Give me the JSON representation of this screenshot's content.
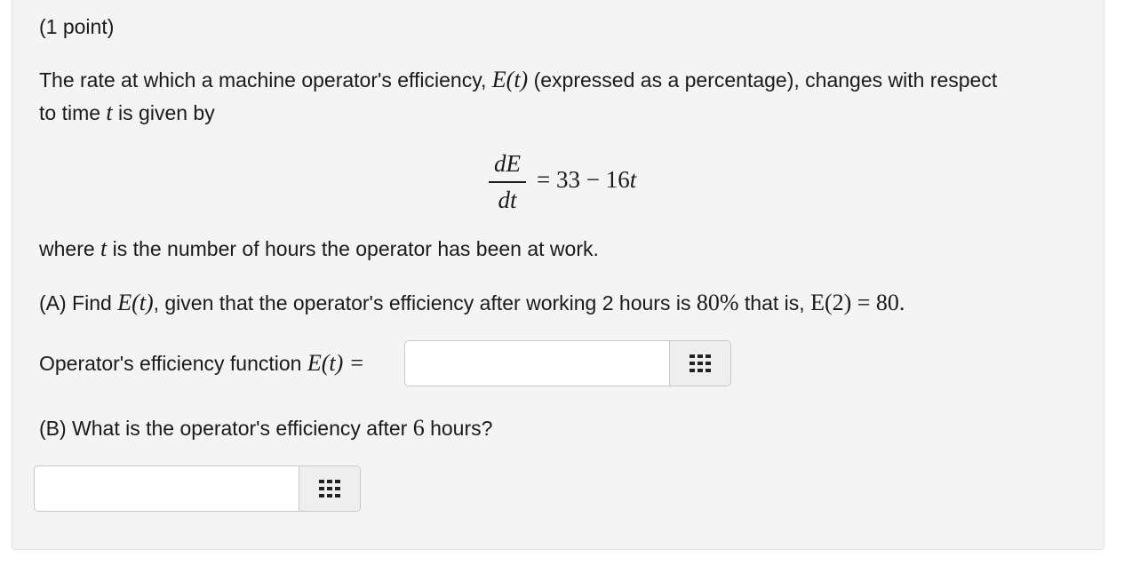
{
  "problem": {
    "points": "(1 point)",
    "intro": {
      "pre": "The rate at which a machine operator's efficiency, ",
      "func": "E(t)",
      "post": " (expressed as a percentage), changes with respect",
      "line2_pre": "to time ",
      "var": "t",
      "line2_post": " is given by"
    },
    "equation": {
      "numerator": "dE",
      "denominator": "dt",
      "rhs": "= 33 − 16",
      "rhs_var": "t"
    },
    "where": {
      "pre": "where ",
      "var": "t",
      "post": " is the number of hours the operator has been at work."
    },
    "part_a": {
      "pre": "(A) Find ",
      "func": "E(t)",
      "mid": ", given that the operator's efficiency after working 2 hours is ",
      "pct": "80%",
      "mid2": " that is, ",
      "cond": "E(2) = 80."
    },
    "answer_a": {
      "label": "Operator's efficiency function ",
      "func": "E(t) =",
      "value": "",
      "placeholder": ""
    },
    "part_b": {
      "pre": "(B) What is the operator's efficiency after ",
      "num": "6",
      "post": " hours?"
    },
    "answer_b": {
      "value": "",
      "placeholder": ""
    }
  }
}
